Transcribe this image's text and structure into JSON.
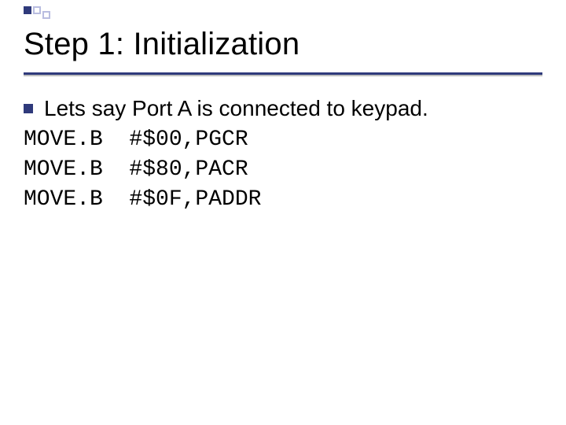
{
  "title": "Step 1: Initialization",
  "bullet": "Lets say Port A is connected to keypad.",
  "code": {
    "l1": "MOVE.B  #$00,PGCR",
    "l2": "MOVE.B  #$80,PACR",
    "l3": "MOVE.B  #$0F,PADDR"
  }
}
